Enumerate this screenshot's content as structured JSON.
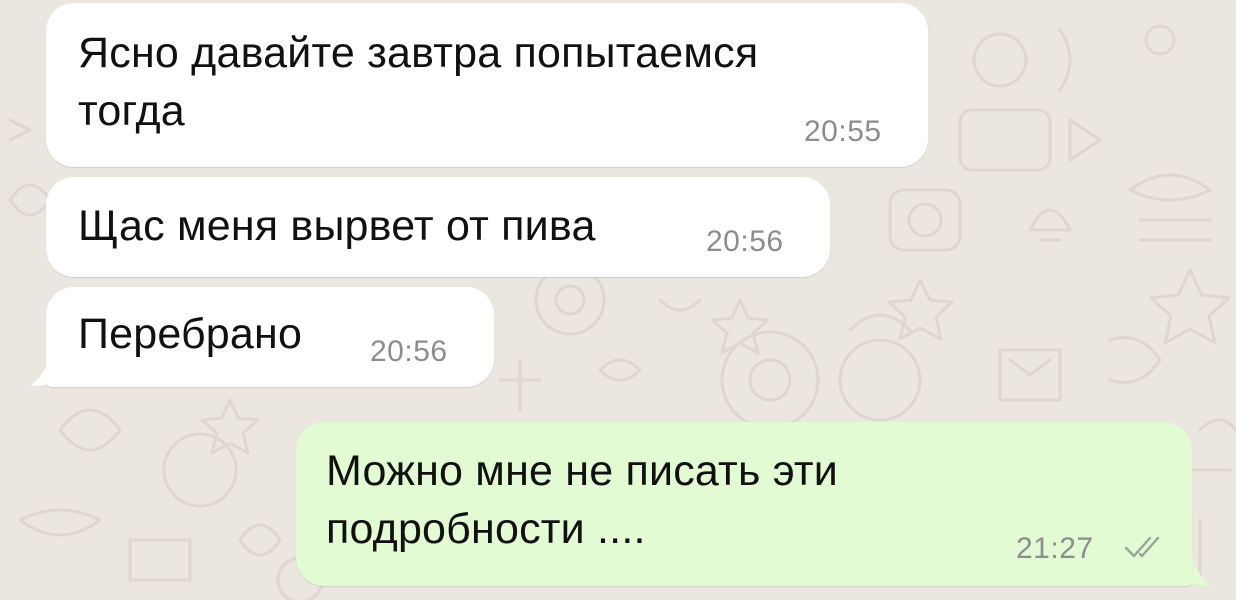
{
  "chat": {
    "messages": [
      {
        "text": "Ясно давайте завтра попытаемся\nтогда",
        "time": "20:55",
        "direction": "incoming"
      },
      {
        "text": "Щас меня вырвет от пива",
        "time": "20:56",
        "direction": "incoming"
      },
      {
        "text": "Перебрано",
        "time": "20:56",
        "direction": "incoming"
      },
      {
        "text": "Можно мне не писать эти\nподробности ....",
        "time": "21:27",
        "direction": "outgoing",
        "status": "read"
      }
    ]
  },
  "colors": {
    "background": "#ebe6df",
    "incoming_bubble": "#ffffff",
    "outgoing_bubble": "#e2fbd3",
    "timestamp": "#8d8d8d",
    "read_check": "#9aa39a"
  },
  "icons": {
    "read_receipt": "double-check-icon"
  }
}
